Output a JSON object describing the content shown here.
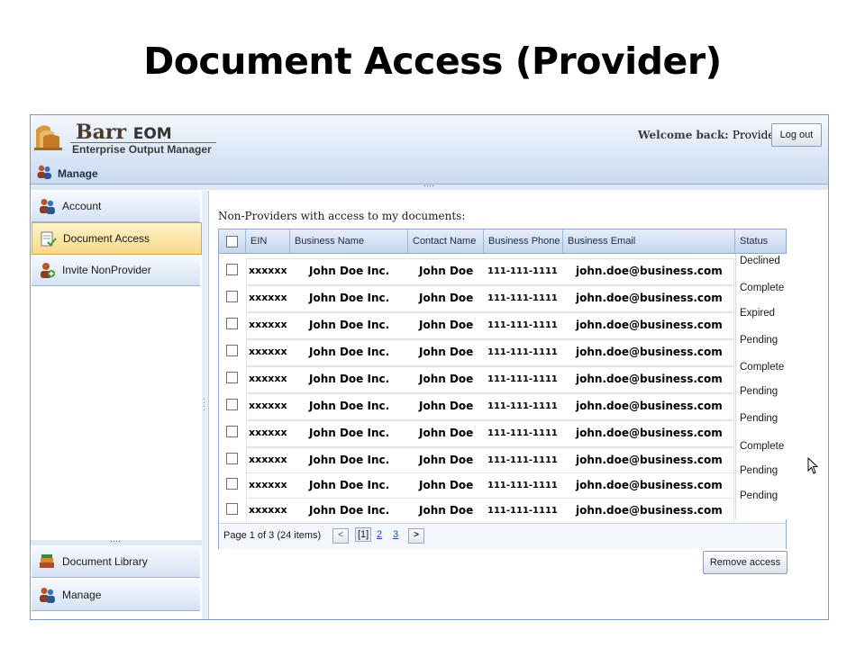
{
  "slide_title": "Document Access (Provider)",
  "header": {
    "logo_name": "Barr",
    "logo_eom": "EOM",
    "logo_sub": "Enterprise Output Manager",
    "manage_label": "Manage",
    "welcome_text": "Welcome back:",
    "user": "Provider",
    "logout_label": "Log out"
  },
  "nav": {
    "top": [
      {
        "label": "Account",
        "icon": "users-icon"
      },
      {
        "label": "Document Access",
        "icon": "document-access-icon"
      },
      {
        "label": "Invite NonProvider",
        "icon": "invite-icon"
      }
    ],
    "bottom": [
      {
        "label": "Document Library",
        "icon": "library-icon"
      },
      {
        "label": "Manage",
        "icon": "users-icon"
      }
    ],
    "active": "Document Access"
  },
  "main": {
    "section_title": "Non-Providers with access to my documents:",
    "columns": [
      "EIN",
      "Business Name",
      "Contact Name",
      "Business Phone",
      "Business Email",
      "Status"
    ],
    "rows": [
      {
        "ein": "xxxxxx",
        "business": "John Doe Inc.",
        "contact": "John Doe",
        "phone": "111-111-1111",
        "email": "john.doe@business.com",
        "status": "Declined"
      },
      {
        "ein": "xxxxxx",
        "business": "John Doe Inc.",
        "contact": "John Doe",
        "phone": "111-111-1111",
        "email": "john.doe@business.com",
        "status": "Complete"
      },
      {
        "ein": "xxxxxx",
        "business": "John Doe Inc.",
        "contact": "John Doe",
        "phone": "111-111-1111",
        "email": "john.doe@business.com",
        "status": "Expired"
      },
      {
        "ein": "xxxxxx",
        "business": "John Doe Inc.",
        "contact": "John Doe",
        "phone": "111-111-1111",
        "email": "john.doe@business.com",
        "status": "Pending"
      },
      {
        "ein": "xxxxxx",
        "business": "John Doe Inc.",
        "contact": "John Doe",
        "phone": "111-111-1111",
        "email": "john.doe@business.com",
        "status": "Complete"
      },
      {
        "ein": "xxxxxx",
        "business": "John Doe Inc.",
        "contact": "John Doe",
        "phone": "111-111-1111",
        "email": "john.doe@business.com",
        "status": "Pending"
      },
      {
        "ein": "xxxxxx",
        "business": "John Doe Inc.",
        "contact": "John Doe",
        "phone": "111-111-1111",
        "email": "john.doe@business.com",
        "status": "Pending"
      },
      {
        "ein": "xxxxxx",
        "business": "John Doe Inc.",
        "contact": "John Doe",
        "phone": "111-111-1111",
        "email": "john.doe@business.com",
        "status": "Complete"
      },
      {
        "ein": "xxxxxx",
        "business": "John Doe Inc.",
        "contact": "John Doe",
        "phone": "111-111-1111",
        "email": "john.doe@business.com",
        "status": "Pending"
      },
      {
        "ein": "xxxxxx",
        "business": "John Doe Inc.",
        "contact": "John Doe",
        "phone": "111-111-1111",
        "email": "john.doe@business.com",
        "status": "Pending"
      }
    ],
    "pager": {
      "summary": "Page 1 of 3 (24 items)",
      "prev": "<",
      "next": ">",
      "pages": [
        "[1]",
        "2",
        "3"
      ]
    },
    "remove_access_label": "Remove access"
  }
}
